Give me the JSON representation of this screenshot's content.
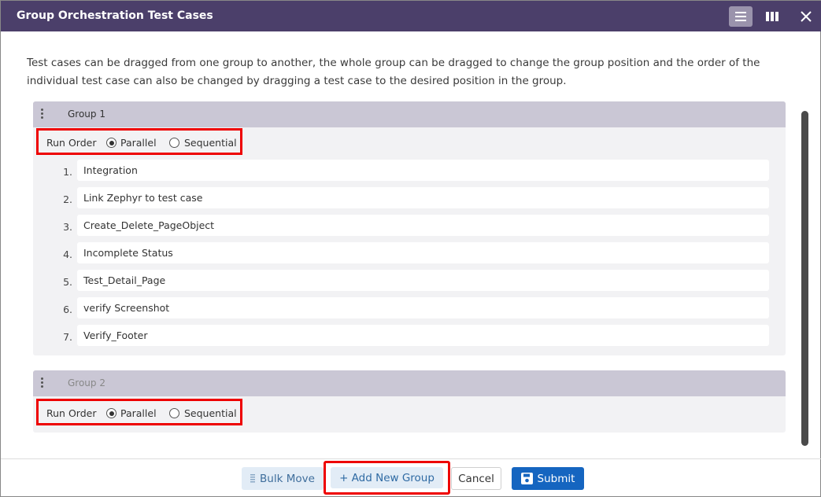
{
  "dialog": {
    "title": "Group Orchestration Test Cases",
    "toolbar": {
      "list_view_icon": "list-view-icon",
      "column_view_icon": "columns-view-icon",
      "close_icon": "close-icon"
    },
    "description": "Test cases can be dragged from one group to another, the whole group can be dragged to change the group position and the order of the individual test case can also be changed by dragging a test case to the desired position in the group."
  },
  "groups": [
    {
      "name": "Group 1",
      "run_order_label": "Run Order",
      "options": [
        "Parallel",
        "Sequential"
      ],
      "selected": "Parallel",
      "test_cases": [
        {
          "num": "1.",
          "name": "Integration"
        },
        {
          "num": "2.",
          "name": "Link Zephyr to test case"
        },
        {
          "num": "3.",
          "name": "Create_Delete_PageObject"
        },
        {
          "num": "4.",
          "name": "Incomplete Status"
        },
        {
          "num": "5.",
          "name": "Test_Detail_Page"
        },
        {
          "num": "6.",
          "name": "verify Screenshot"
        },
        {
          "num": "7.",
          "name": "Verify_Footer"
        }
      ]
    },
    {
      "name": "Group 2",
      "run_order_label": "Run Order",
      "options": [
        "Parallel",
        "Sequential"
      ],
      "selected": "Parallel",
      "test_cases": []
    }
  ],
  "footer": {
    "bulk_move_label": "Bulk Move",
    "add_group_label": "+ Add New Group",
    "cancel_label": "Cancel",
    "submit_label": "Submit"
  },
  "colors": {
    "title_bar": "#4b3f6a",
    "group_header": "#cac7d5",
    "highlight_border": "#ee0000",
    "submit_button": "#1565c0"
  }
}
